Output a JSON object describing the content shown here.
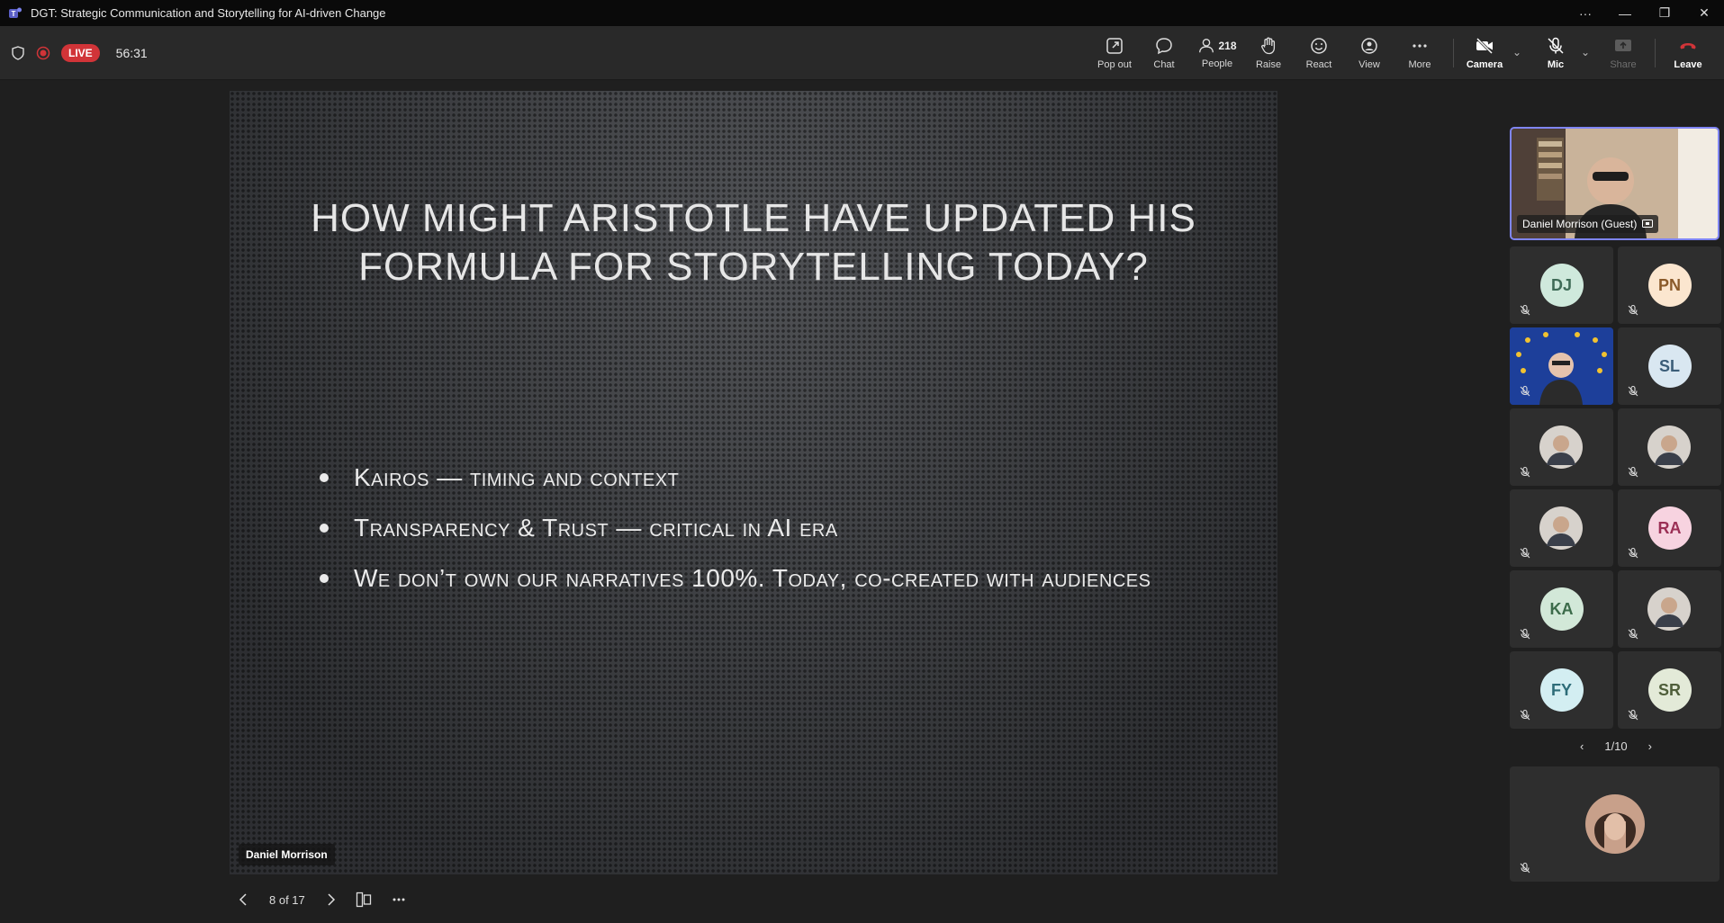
{
  "window": {
    "title": "DGT: Strategic Communication and Storytelling for AI-driven Change"
  },
  "toolbar": {
    "live_label": "LIVE",
    "timer": "56:31",
    "popout_label": "Pop out",
    "chat_label": "Chat",
    "people_count": "218",
    "people_label": "People",
    "raise_label": "Raise",
    "react_label": "React",
    "view_label": "View",
    "more_label": "More",
    "camera_label": "Camera",
    "mic_label": "Mic",
    "share_label": "Share",
    "leave_label": "Leave",
    "leave_color": "#d13438"
  },
  "slide": {
    "title_line1": "HOW MIGHT ARISTOTLE HAVE UPDATED HIS",
    "title_line2": "FORMULA FOR STORYTELLING TODAY?",
    "bullets": [
      "Kairos — timing and context",
      "Transparency & Trust — critical in AI era",
      "We don’t own our narratives 100%. Today, co-created with audiences"
    ],
    "presenter": "Daniel Morrison"
  },
  "slide_nav": {
    "counter": "8 of 17"
  },
  "participants": {
    "featured_name": "Daniel Morrison (Guest)",
    "tiles": [
      {
        "initials": "DJ",
        "bg": "#cfe9dc",
        "fg": "#3f6b57"
      },
      {
        "initials": "PN",
        "bg": "#fbe6cf",
        "fg": "#8a5a2a"
      },
      {
        "initials": "",
        "bg": "#1d3f9a",
        "fg": "#fff"
      },
      {
        "initials": "SL",
        "bg": "#d9e7f1",
        "fg": "#3b5d78"
      },
      {
        "initials": "",
        "bg": "#2f3030",
        "fg": "#fff"
      },
      {
        "initials": "",
        "bg": "#2f3030",
        "fg": "#fff"
      },
      {
        "initials": "",
        "bg": "#2f3030",
        "fg": "#fff"
      },
      {
        "initials": "RA",
        "bg": "#f7d3e0",
        "fg": "#9b2f55"
      },
      {
        "initials": "KA",
        "bg": "#d2e8d8",
        "fg": "#3c6b4a"
      },
      {
        "initials": "",
        "bg": "#2f3030",
        "fg": "#fff"
      },
      {
        "initials": "FY",
        "bg": "#d3eef2",
        "fg": "#2d6c78"
      },
      {
        "initials": "SR",
        "bg": "#e3ead8",
        "fg": "#4f5e3a"
      }
    ],
    "pager": "1/10"
  }
}
